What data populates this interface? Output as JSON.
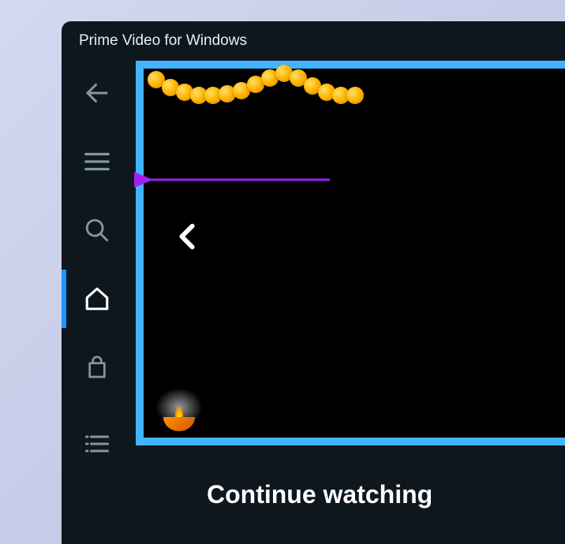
{
  "window": {
    "title": "Prime Video for Windows"
  },
  "sidebar": {
    "back_icon": "back",
    "menu_icon": "menu",
    "search_icon": "search",
    "home_icon": "home",
    "store_icon": "store",
    "list_icon": "list"
  },
  "carousel": {
    "prev_icon": "chevron-left"
  },
  "section": {
    "continue_watching": "Continue watching"
  },
  "annotation": {
    "target": "menu-button"
  }
}
